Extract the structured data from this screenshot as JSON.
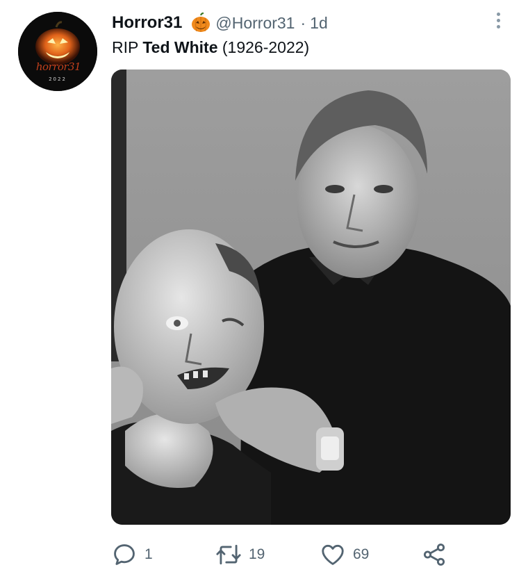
{
  "tweet": {
    "display_name": "Horror31",
    "badge_icon": "jack-o-lantern-emoji",
    "handle": "@Horror31",
    "separator": "·",
    "time": "1d",
    "text_prefix": "RIP ",
    "text_bold": "Ted White",
    "text_suffix": " (1926-2022)"
  },
  "avatar": {
    "logo_text": "horror31",
    "logo_year": "2022"
  },
  "media": {
    "description_icon": "photo"
  },
  "actions": {
    "reply": {
      "icon": "reply-icon",
      "count": "1"
    },
    "retweet": {
      "icon": "retweet-icon",
      "count": "19"
    },
    "like": {
      "icon": "heart-icon",
      "count": "69"
    },
    "share": {
      "icon": "share-icon"
    }
  },
  "colors": {
    "text_primary": "#0f1419",
    "text_secondary": "#536471",
    "accent_orange": "#f08a1c"
  }
}
